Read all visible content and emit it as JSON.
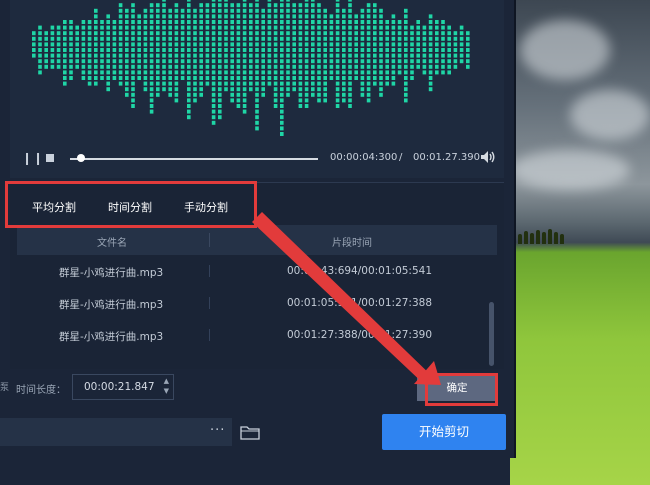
{
  "player": {
    "pause_icon": "pause-icon",
    "stop_icon": "stop-icon",
    "progress": 0.03,
    "current_time": "00:00:04:300",
    "separator": "/",
    "total_time": "00:01.27.390",
    "volume_icon": "speaker-icon"
  },
  "split_modes": {
    "tabs": [
      "平均分割",
      "时间分割",
      "手动分割"
    ]
  },
  "table": {
    "headers": [
      "文件名",
      "片段时间"
    ],
    "rows": [
      {
        "name": "群星-小鸡进行曲.mp3",
        "range": "00:00:43:694/00:01:05:541"
      },
      {
        "name": "群星-小鸡进行曲.mp3",
        "range": "00:01:05:541/00:01:27:388"
      },
      {
        "name": "群星-小鸡进行曲.mp3",
        "range": "00:01:27:388/00:01:27:390"
      }
    ]
  },
  "duration": {
    "cut_label_fragment": "泵",
    "label": "时间长度：",
    "value": "00:00:21.847"
  },
  "buttons": {
    "confirm": "确定",
    "start": "开始剪切",
    "browse_dots": "···"
  },
  "icons": {
    "folder": "folder-icon",
    "spin_up": "chevron-up-icon",
    "spin_down": "chevron-down-icon"
  },
  "colors": {
    "waveform": "#1fd6a6",
    "primary_button": "#2f83f0",
    "highlight": "#e23b3b",
    "background": "#1b2538"
  }
}
